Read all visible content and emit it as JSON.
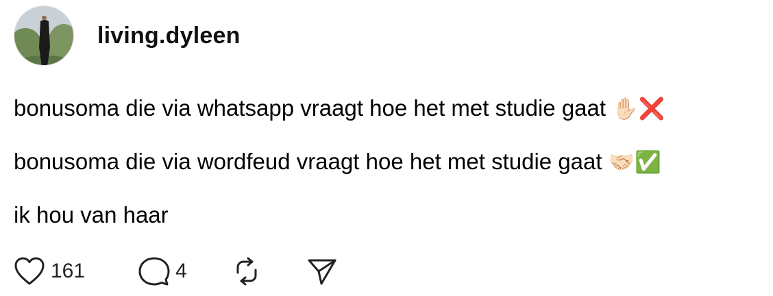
{
  "post": {
    "username": "living.dyleen",
    "lines": [
      {
        "text": "bonusoma die via whatsapp vraagt hoe het met studie gaat",
        "emoji": "✋🏻❌"
      },
      {
        "text": "bonusoma die via wordfeud vraagt hoe het met studie gaat",
        "emoji": "🤝🏻✅"
      },
      {
        "text": "ik hou van haar",
        "emoji": ""
      }
    ]
  },
  "actions": {
    "likes": "161",
    "replies": "4",
    "like_icon": "heart-icon",
    "reply_icon": "speech-bubble-icon",
    "repost_icon": "repost-icon",
    "share_icon": "send-icon"
  }
}
